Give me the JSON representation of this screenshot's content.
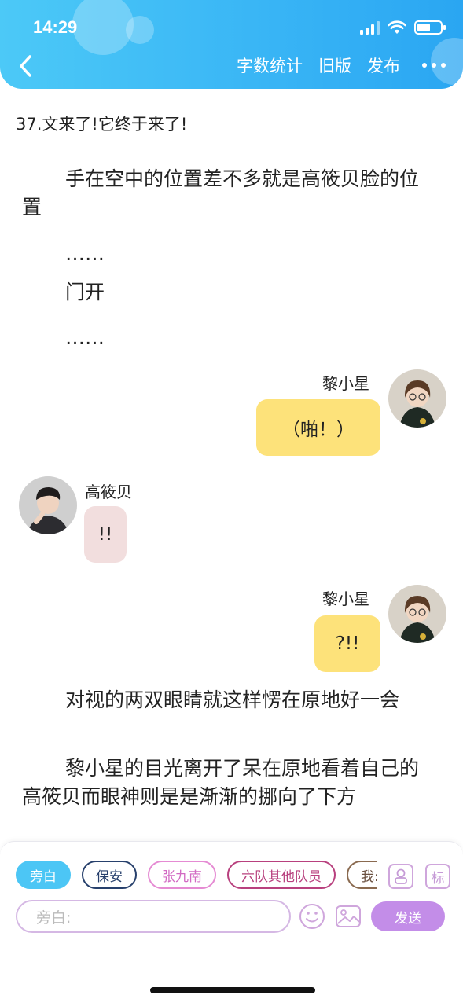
{
  "status_bar": {
    "time": "14:29"
  },
  "nav": {
    "word_count_label": "字数统计",
    "old_version_label": "旧版",
    "publish_label": "发布"
  },
  "content": {
    "chapter_title": "37.文来了!它终于来了!",
    "paragraphs": [
      "手在空中的位置差不多就是高筱贝脸的位置",
      "……",
      "门开",
      "……",
      "对视的两双眼睛就这样愣在原地好一会",
      "黎小星的目光离开了呆在原地看着自己的高筱贝而眼神则是是渐渐的挪向了下方"
    ],
    "messages": [
      {
        "speaker": "黎小星",
        "text": "（啪！）",
        "side": "right"
      },
      {
        "speaker": "高筱贝",
        "text": "!!",
        "side": "left"
      },
      {
        "speaker": "黎小星",
        "text": "?!!",
        "side": "right"
      }
    ]
  },
  "composer": {
    "roles": [
      "旁白",
      "保安",
      "张九南",
      "六队其他队员",
      "我:"
    ],
    "active_role": "旁白",
    "role_icon_label": "",
    "tag_icon_label": "标",
    "input_placeholder": "旁白:",
    "send_label": "发送"
  },
  "colors": {
    "header_gradient_start": "#4cc9f7",
    "header_gradient_end": "#2aa6f2",
    "my_bubble": "#fde27a",
    "other_bubble": "#f2dede",
    "send_button": "#c38de8"
  }
}
